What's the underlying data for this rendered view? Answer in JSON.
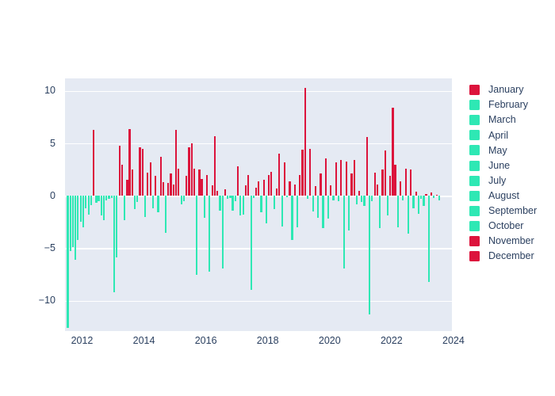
{
  "chart_data": {
    "type": "bar",
    "title": "",
    "xlabel": "",
    "ylabel": "",
    "xlim": [
      2011.45,
      2023.95
    ],
    "ylim": [
      -12.9,
      11.2
    ],
    "ytick_labels": [
      "10",
      "5",
      "0",
      "−5",
      "−10"
    ],
    "ytick_values": [
      10,
      5,
      0,
      -5,
      -10
    ],
    "xtick_labels": [
      "2012",
      "2014",
      "2016",
      "2018",
      "2020",
      "2022",
      "2024"
    ],
    "xtick_values": [
      2012,
      2014,
      2016,
      2018,
      2020,
      2022,
      2024
    ],
    "grid": true,
    "legend_position": "right",
    "plot_bgcolor": "#E5EAF3",
    "paper_bgcolor": "#FFFFFF",
    "gridcolor": "#FFFFFF",
    "tick_font_color": "#2a3f5f",
    "positive_color": "#DC143C",
    "negative_color": "#2EE8B4",
    "legend": [
      {
        "label": "January",
        "color": "#DC143C"
      },
      {
        "label": "February",
        "color": "#2EE8B4"
      },
      {
        "label": "March",
        "color": "#2EE8B4"
      },
      {
        "label": "April",
        "color": "#2EE8B4"
      },
      {
        "label": "May",
        "color": "#2EE8B4"
      },
      {
        "label": "June",
        "color": "#2EE8B4"
      },
      {
        "label": "July",
        "color": "#2EE8B4"
      },
      {
        "label": "August",
        "color": "#2EE8B4"
      },
      {
        "label": "September",
        "color": "#2EE8B4"
      },
      {
        "label": "October",
        "color": "#2EE8B4"
      },
      {
        "label": "November",
        "color": "#DC143C"
      },
      {
        "label": "December",
        "color": "#DC143C"
      }
    ],
    "x": [
      2011.54,
      2011.62,
      2011.71,
      2011.79,
      2011.87,
      2011.96,
      2012.04,
      2012.12,
      2012.21,
      2012.29,
      2012.37,
      2012.46,
      2012.54,
      2012.62,
      2012.71,
      2012.79,
      2012.87,
      2012.96,
      2013.04,
      2013.12,
      2013.21,
      2013.29,
      2013.37,
      2013.46,
      2013.54,
      2013.62,
      2013.71,
      2013.79,
      2013.87,
      2013.96,
      2014.04,
      2014.12,
      2014.21,
      2014.29,
      2014.37,
      2014.46,
      2014.54,
      2014.62,
      2014.71,
      2014.79,
      2014.87,
      2014.96,
      2015.04,
      2015.12,
      2015.21,
      2015.29,
      2015.37,
      2015.46,
      2015.54,
      2015.62,
      2015.71,
      2015.79,
      2015.87,
      2015.96,
      2016.04,
      2016.12,
      2016.21,
      2016.29,
      2016.37,
      2016.46,
      2016.54,
      2016.62,
      2016.71,
      2016.79,
      2016.87,
      2016.96,
      2017.04,
      2017.12,
      2017.21,
      2017.29,
      2017.37,
      2017.46,
      2017.54,
      2017.62,
      2017.71,
      2017.79,
      2017.87,
      2017.96,
      2018.04,
      2018.12,
      2018.21,
      2018.29,
      2018.37,
      2018.46,
      2018.54,
      2018.62,
      2018.71,
      2018.79,
      2018.87,
      2018.96,
      2019.04,
      2019.12,
      2019.21,
      2019.29,
      2019.37,
      2019.46,
      2019.54,
      2019.62,
      2019.71,
      2019.79,
      2019.87,
      2019.96,
      2020.04,
      2020.12,
      2020.21,
      2020.29,
      2020.37,
      2020.46,
      2020.54,
      2020.62,
      2020.71,
      2020.79,
      2020.87,
      2020.96,
      2021.04,
      2021.12,
      2021.21,
      2021.29,
      2021.37,
      2021.46,
      2021.54,
      2021.62,
      2021.71,
      2021.79,
      2021.87,
      2021.96,
      2022.04,
      2022.12,
      2022.21,
      2022.29,
      2022.37,
      2022.46,
      2022.54,
      2022.62,
      2022.71,
      2022.79,
      2022.87,
      2022.96,
      2023.04,
      2023.12,
      2023.21,
      2023.29,
      2023.37,
      2023.46,
      2023.54
    ],
    "values": [
      -12.6,
      -5.3,
      -4.9,
      -6.1,
      -4.2,
      -2.5,
      -3.0,
      -1.2,
      -1.8,
      -0.9,
      6.3,
      -0.7,
      -0.5,
      -1.9,
      -2.3,
      -0.4,
      -0.3,
      -0.2,
      -9.2,
      -5.9,
      4.8,
      3.0,
      -2.3,
      1.5,
      6.4,
      2.5,
      -1.3,
      -0.6,
      4.6,
      4.5,
      -2.0,
      2.2,
      3.2,
      -1.2,
      1.9,
      -1.6,
      3.7,
      1.3,
      -3.5,
      1.2,
      2.1,
      1.1,
      6.3,
      2.6,
      -0.8,
      -0.5,
      1.9,
      4.6,
      5.0,
      2.6,
      -7.5,
      2.5,
      1.6,
      -2.1,
      2.0,
      -7.2,
      1.0,
      5.7,
      0.5,
      -1.4,
      -6.9,
      0.6,
      -0.3,
      -0.2,
      -1.4,
      -0.5,
      2.8,
      -1.9,
      -1.8,
      1.0,
      2.0,
      -9.0,
      -0.2,
      0.8,
      1.4,
      -1.6,
      1.5,
      -2.6,
      2.0,
      2.3,
      -1.3,
      0.7,
      4.0,
      -2.9,
      3.2,
      -0.1,
      1.4,
      -4.2,
      1.1,
      -3.0,
      2.0,
      4.4,
      10.3,
      -0.3,
      4.5,
      -1.5,
      0.9,
      -2.1,
      2.1,
      -3.1,
      3.6,
      -2.2,
      1.0,
      -0.4,
      3.2,
      -0.5,
      3.4,
      -6.9,
      3.3,
      -3.3,
      2.1,
      3.4,
      -0.8,
      0.5,
      -0.6,
      -1.0,
      5.6,
      -11.3,
      -0.5,
      2.2,
      1.1,
      -3.1,
      2.5,
      4.3,
      -1.9,
      1.9,
      8.4,
      3.0,
      -3.0,
      1.4,
      -0.4,
      2.6,
      -3.6,
      2.5,
      -1.2,
      0.4,
      -1.7,
      -0.3,
      -1.0,
      0.2,
      -8.2,
      0.3,
      -0.2,
      0.1,
      -0.4
    ]
  }
}
